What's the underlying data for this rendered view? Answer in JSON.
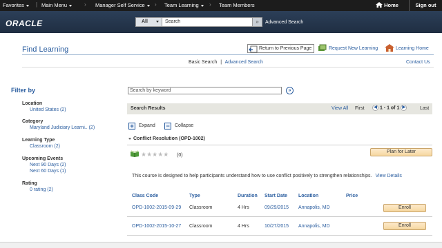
{
  "topnav": {
    "favorites": "Favorites",
    "main_menu": "Main Menu",
    "crumbs": [
      "Manager Self Service",
      "Team Learning",
      "Team Members"
    ],
    "home": "Home",
    "sign_out": "Sign out"
  },
  "banner": {
    "logo": "ORACLE",
    "search_scope": "All",
    "search_value": "Search",
    "advanced_search": "Advanced Search"
  },
  "page": {
    "title": "Find Learning",
    "return_label": "Return to Previous Page",
    "request_label": "Request New Learning",
    "learning_home_label": "Learning Home",
    "basic_search": "Basic Search",
    "separator": "|",
    "advanced_search": "Advanced Search",
    "contact_us": "Contact Us"
  },
  "filters": {
    "title": "Filter by",
    "groups": [
      {
        "title": "Location",
        "items": [
          "United States (2)"
        ]
      },
      {
        "title": "Category",
        "items": [
          "Maryland Judiciary Learni.. (2)"
        ]
      },
      {
        "title": "Learning Type",
        "items": [
          "Classroom (2)"
        ]
      },
      {
        "title": "Upcoming Events",
        "items": [
          "Next 90 Days (2)",
          "Next 60 Days (1)"
        ]
      },
      {
        "title": "Rating",
        "items": [
          "0 rating (2)"
        ]
      }
    ]
  },
  "results": {
    "keyword_placeholder": "Search by keyword",
    "header": "Search Results",
    "view_all": "View All",
    "first": "First",
    "page_info": "1 - 1 of 1",
    "last": "Last",
    "expand": "Expand",
    "collapse": "Collapse"
  },
  "course": {
    "title": "Conflict Resolution (OPD-1002)",
    "stars": "★★★★★",
    "rating_count": "(0)",
    "plan_button": "Plan for Later",
    "description": "This course is designed to help participants understand how to use conflict positively to strengthen relationships.",
    "view_details": "View Details",
    "columns": [
      "Class Code",
      "Type",
      "Duration",
      "Start Date",
      "Location",
      "Price"
    ],
    "classes": [
      {
        "code": "OPD-1002-2015-09-29",
        "type": "Classroom",
        "duration": "4 Hrs",
        "start": "09/29/2015",
        "location": "Annapolis, MD",
        "price": "",
        "action": "Enroll"
      },
      {
        "code": "OPD-1002-2015-10-27",
        "type": "Classroom",
        "duration": "4 Hrs",
        "start": "10/27/2015",
        "location": "Annapolis, MD",
        "price": "",
        "action": "Enroll"
      }
    ]
  },
  "colors": {
    "link": "#2a5d9f",
    "topbar": "#1c1c1c",
    "banner": "#2c3f58",
    "button": "#f6d7a0"
  }
}
